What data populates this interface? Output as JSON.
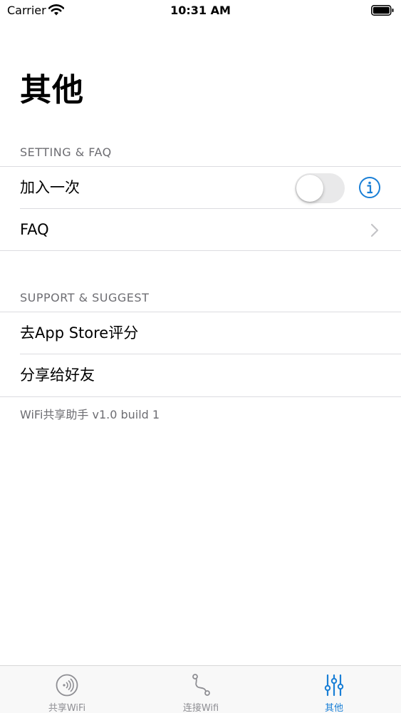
{
  "status_bar": {
    "carrier": "Carrier",
    "time": "10:31 AM"
  },
  "title": "其他",
  "sections": [
    {
      "header": "SETTING & FAQ",
      "rows": [
        {
          "label": "加入一次",
          "accessory": "toggle",
          "toggle_on": false,
          "extra": "info-icon"
        },
        {
          "label": "FAQ",
          "accessory": "chevron-right-icon"
        }
      ]
    },
    {
      "header": "SUPPORT & SUGGEST",
      "rows": [
        {
          "label": "去App Store评分"
        },
        {
          "label": "分享给好友"
        }
      ]
    }
  ],
  "footer": "WiFi共享助手 v1.0 build 1",
  "tab_bar": {
    "tabs": [
      {
        "label": "共享WiFi",
        "icon": "wifi-signal-icon",
        "active": false
      },
      {
        "label": "连接Wifi",
        "icon": "connection-path-icon",
        "active": false
      },
      {
        "label": "其他",
        "icon": "sliders-icon",
        "active": true
      }
    ]
  },
  "colors": {
    "accent": "#1a7fd6",
    "secondary_text": "#6d6d72",
    "separator": "#dcdce0",
    "toggle_off": "#e9e9ea"
  }
}
